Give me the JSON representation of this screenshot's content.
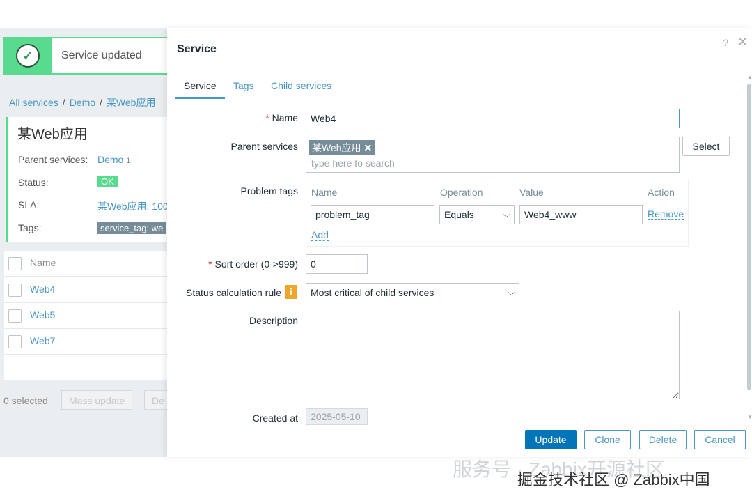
{
  "toast": {
    "message": "Service updated"
  },
  "breadcrumb": {
    "items": [
      "All services",
      "Demo",
      "某Web应用"
    ]
  },
  "service_card": {
    "title": "某Web应用",
    "parent_label": "Parent services:",
    "parent_value": "Demo",
    "parent_count": "1",
    "status_label": "Status:",
    "status_value": "OK",
    "sla_label": "SLA:",
    "sla_value": "某Web应用: 100",
    "tags_label": "Tags:",
    "tags_value": "service_tag: we"
  },
  "list": {
    "header": "Name",
    "rows": [
      "Web4",
      "Web5",
      "Web7"
    ],
    "selected_text": "0 selected",
    "mass_update": "Mass update",
    "delete_partial": "De"
  },
  "modal": {
    "title": "Service",
    "help": "?",
    "close": "✕",
    "tabs": [
      "Service",
      "Tags",
      "Child services"
    ],
    "name_label": "Name",
    "name_value": "Web4",
    "parent_label": "Parent services",
    "parent_chip": "某Web应用",
    "parent_placeholder": "type here to search",
    "select_button": "Select",
    "problem_tags_label": "Problem tags",
    "pt_headers": {
      "name": "Name",
      "operation": "Operation",
      "value": "Value",
      "action": "Action"
    },
    "pt_row": {
      "name": "problem_tag",
      "operation": "Equals",
      "value": "Web4_www",
      "action": "Remove"
    },
    "pt_add": "Add",
    "sort_label": "Sort order (0->999)",
    "sort_value": "0",
    "status_rule_label": "Status calculation rule",
    "status_rule_value": "Most critical of child services",
    "description_label": "Description",
    "created_label": "Created at",
    "created_value": "2025-05-10",
    "buttons": {
      "update": "Update",
      "clone": "Clone",
      "delete": "Delete",
      "cancel": "Cancel"
    }
  },
  "watermark": {
    "line1": "服务号 · Zabbix开源社区",
    "line2": "掘金技术社区 @ Zabbix中国"
  },
  "colors": {
    "accent": "#0275b8",
    "link": "#4796c4",
    "ok": "#59db8f",
    "required": "#e33734"
  }
}
